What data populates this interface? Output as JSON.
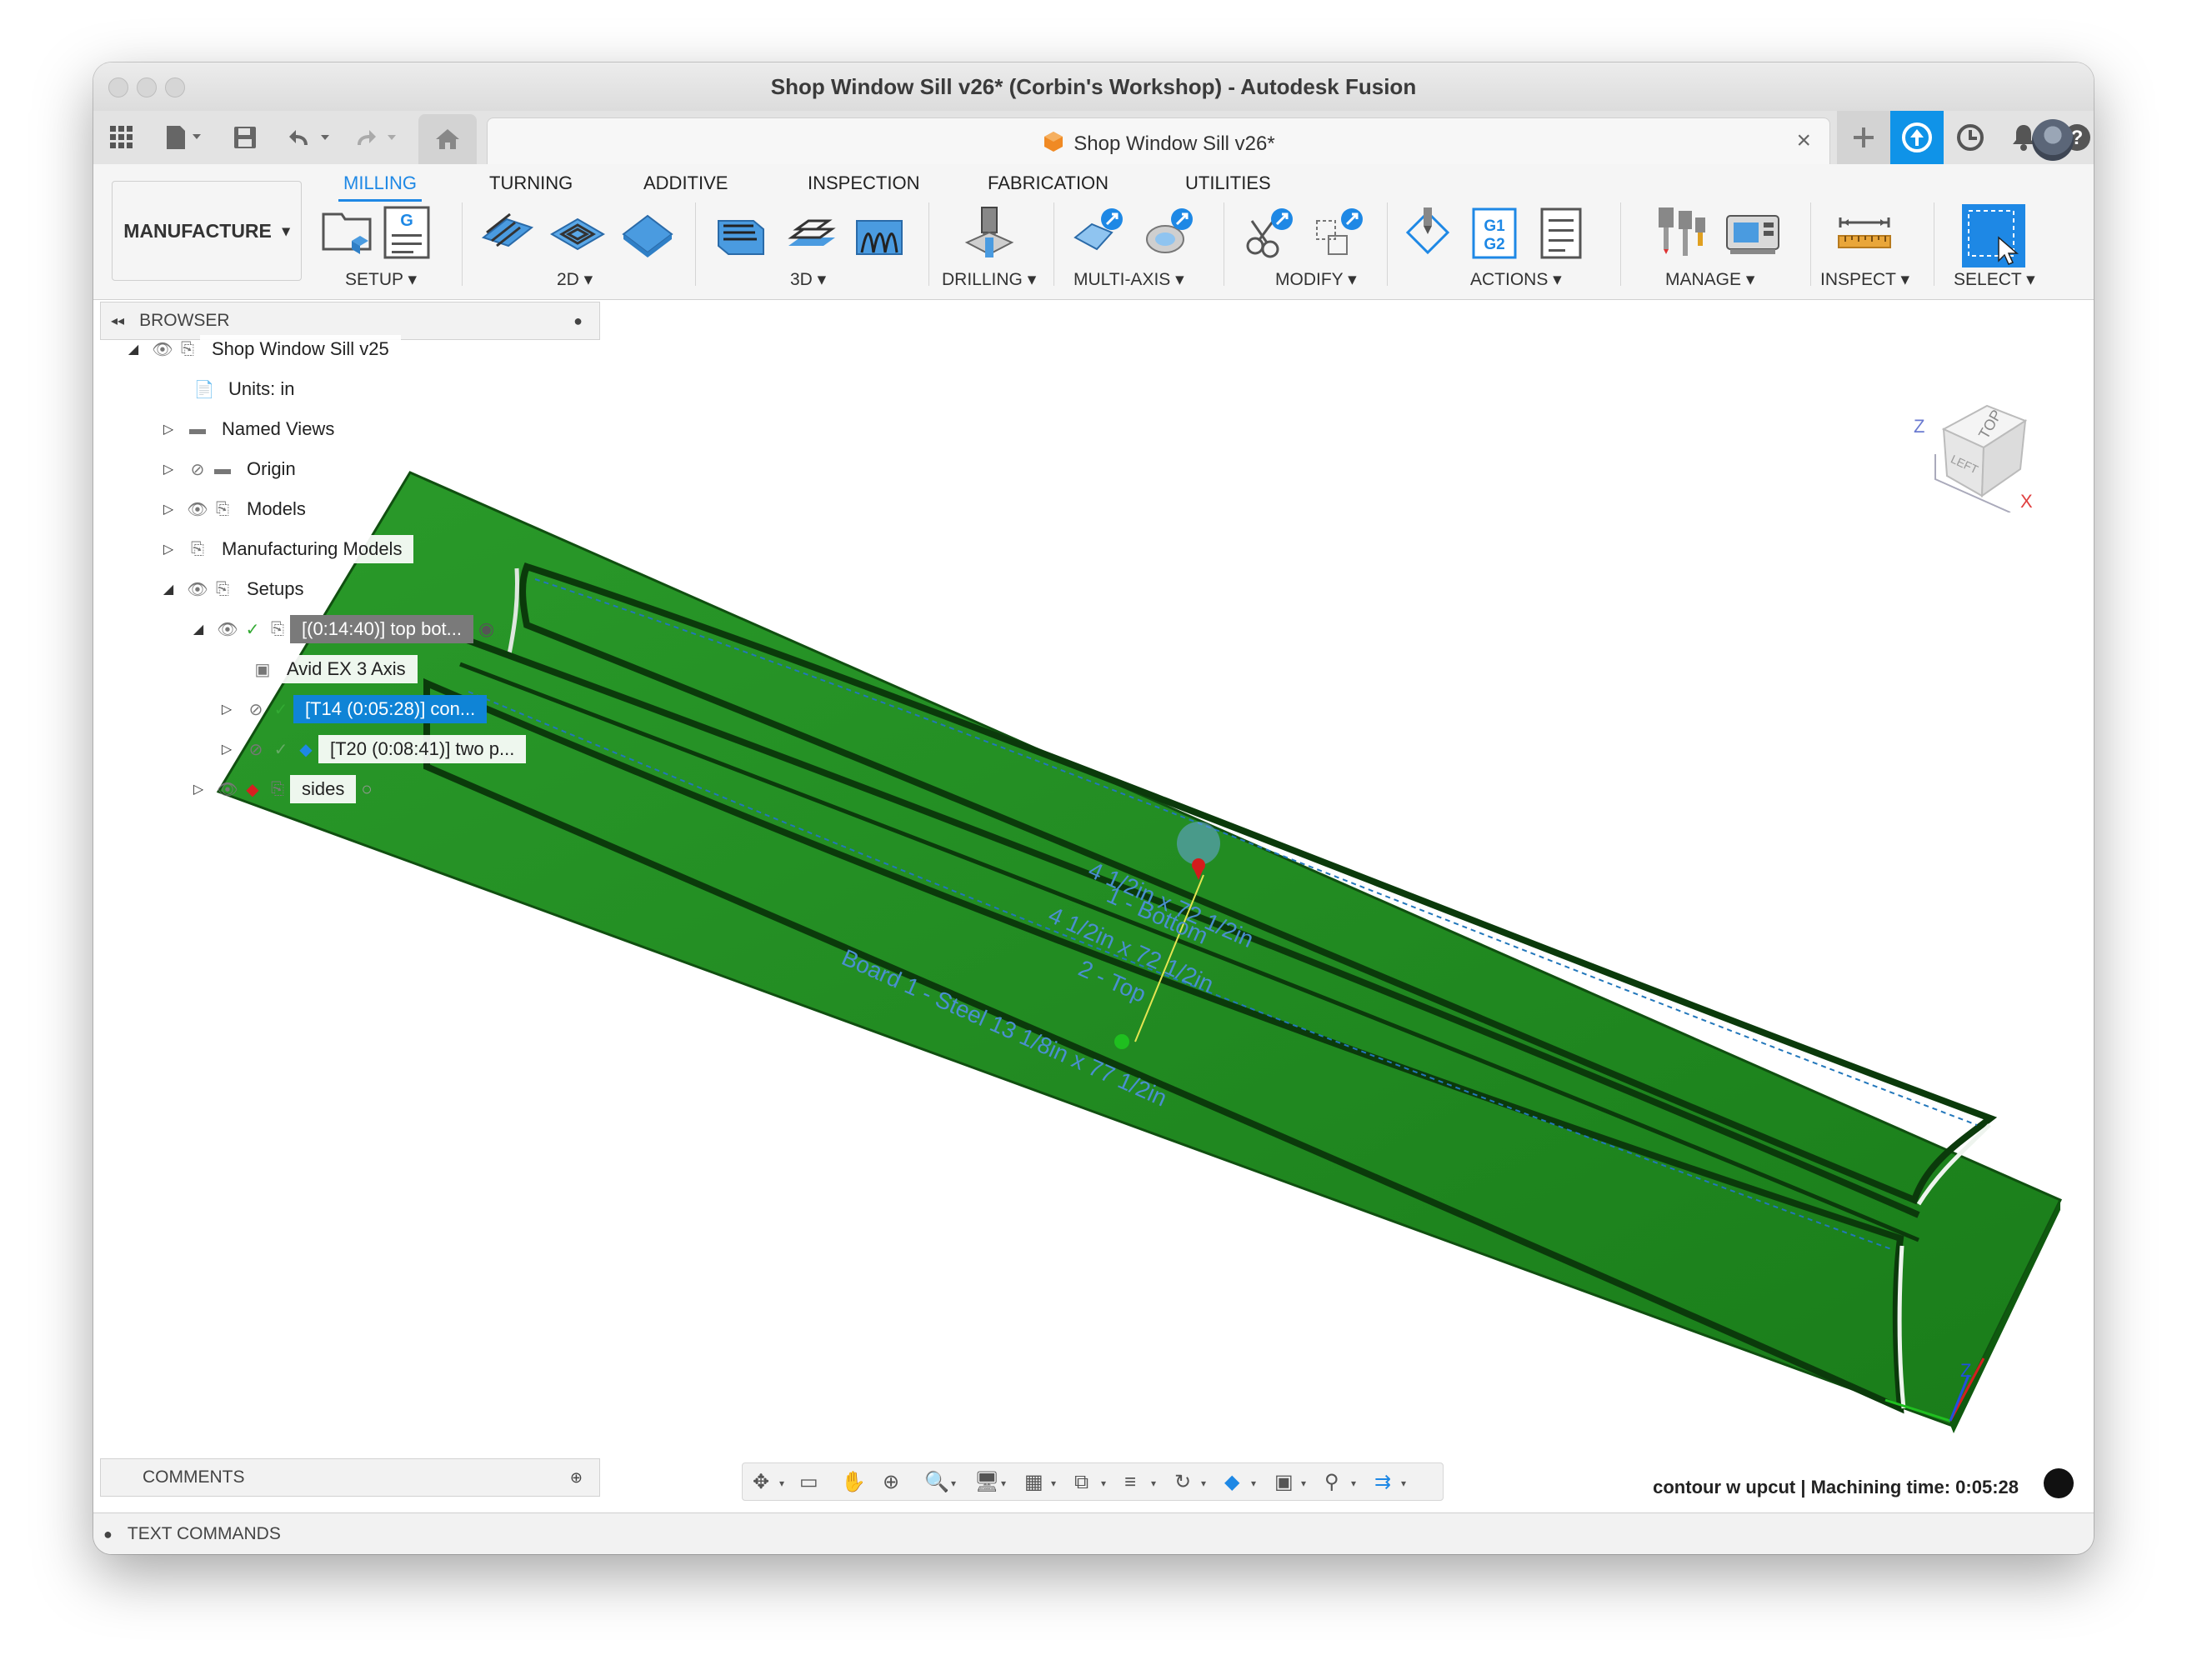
{
  "window": {
    "title": "Shop Window Sill v26* (Corbin's Workshop) - Autodesk Fusion"
  },
  "doc_tab": {
    "title": "Shop Window Sill v26*",
    "close_glyph": "×"
  },
  "workspace": {
    "label": "MANUFACTURE",
    "chevron": "▾"
  },
  "ribbon_tabs": [
    "MILLING",
    "TURNING",
    "ADDITIVE",
    "INSPECTION",
    "FABRICATION",
    "UTILITIES"
  ],
  "ribbon_groups": [
    "SETUP ▾",
    "2D ▾",
    "3D ▾",
    "DRILLING ▾",
    "MULTI-AXIS ▾",
    "MODIFY ▾",
    "ACTIONS ▾",
    "MANAGE ▾",
    "INSPECT ▾",
    "SELECT ▾"
  ],
  "browser": {
    "header": "BROWSER",
    "items": {
      "root": "Shop Window Sill v25",
      "units": "Units: in",
      "named_views": "Named Views",
      "origin": "Origin",
      "models": "Models",
      "manufacturing_models": "Manufacturing Models",
      "setups": "Setups",
      "setup1": "[(0:14:40)] top bot...",
      "machine": "Avid EX 3 Axis",
      "op1": "[T14 (0:05:28)] con...",
      "op2": "[T20 (0:08:41)] two p...",
      "setup2": "sides"
    }
  },
  "comments": {
    "header": "COMMENTS"
  },
  "text_commands": {
    "label": "TEXT COMMANDS"
  },
  "status": {
    "text": "contour w upcut | Machining time: 0:05:28"
  },
  "viewcube": {
    "top": "TOP",
    "left": "LEFT",
    "axis_x": "X",
    "axis_z": "Z"
  },
  "model_labels": {
    "l1": "4 1/2in x 72 1/2in",
    "l2": "1 - Bottom",
    "l3": "4 1/2in x 72 1/2in",
    "l4": "2 - Top",
    "l5": "Board 1 - Steel 13 1/8in x 77 1/2in"
  },
  "colors": {
    "stock_green": "#1e8a1e",
    "accent_blue": "#1e88e5",
    "selection_blue": "#0f84d6"
  }
}
